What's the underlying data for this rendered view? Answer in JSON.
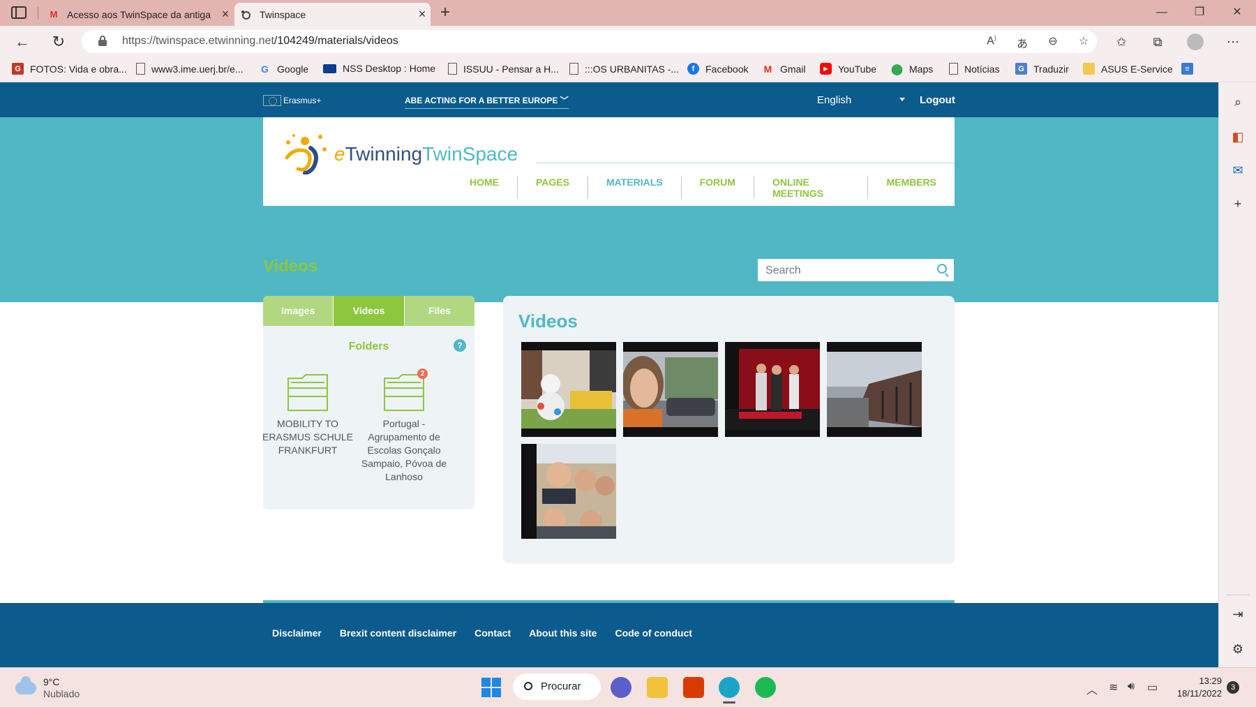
{
  "browser": {
    "tabs": [
      {
        "title": "Acesso aos TwinSpace da antiga",
        "icon": "gmail-icon"
      },
      {
        "title": "Twinspace",
        "icon": "etwinning-icon"
      }
    ],
    "url_host": "https://twinspace.etwinning.net",
    "url_path": "/104249/materials/videos",
    "bookmarks": [
      "FOTOS: Vida e obra...",
      "www3.ime.uerj.br/e...",
      "Google",
      "NSS Desktop : Home",
      "ISSUU - Pensar a H...",
      ":::OS URBANITAS -...",
      "Facebook",
      "Gmail",
      "YouTube",
      "Maps",
      "Notícias",
      "Traduzir",
      "ASUS E-Service"
    ]
  },
  "site": {
    "erasmus": "Erasmus+",
    "campaign": "ABE ACTING FOR A BETTER EUROPE",
    "language": "English",
    "logout": "Logout",
    "brand_e": "e",
    "brand_twinning": "Twinning",
    "brand_twinspace": "TwinSpace",
    "nav": [
      "HOME",
      "PAGES",
      "MATERIALS",
      "FORUM",
      "ONLINE MEETINGS",
      "MEMBERS"
    ],
    "active_nav": "MATERIALS"
  },
  "content": {
    "page_title": "Videos",
    "search_placeholder": "Search",
    "tabs": [
      "Images",
      "Videos",
      "Files"
    ],
    "active_tab": "Videos",
    "folders_title": "Folders",
    "help": "?",
    "folders": [
      {
        "name": "MOBILITY TO ERASMUS SCHULE FRANKFURT",
        "badge": ""
      },
      {
        "name": "Portugal - Agrupamento de Escolas Gonçalo Sampaio, Póvoa de Lanhoso",
        "badge": "2"
      }
    ],
    "videos_title": "Videos",
    "video_count": 5
  },
  "footer": {
    "links": [
      "Disclaimer",
      "Brexit content disclaimer",
      "Contact",
      "About this site",
      "Code of conduct"
    ]
  },
  "taskbar": {
    "temperature": "9°C",
    "weather": "Nublado",
    "search": "Procurar",
    "time": "13:29",
    "date": "18/11/2022",
    "notifications": "3"
  },
  "colors": {
    "brand_blue": "#0b5b8c",
    "teal": "#4fb8c4",
    "green": "#8dc63f"
  }
}
